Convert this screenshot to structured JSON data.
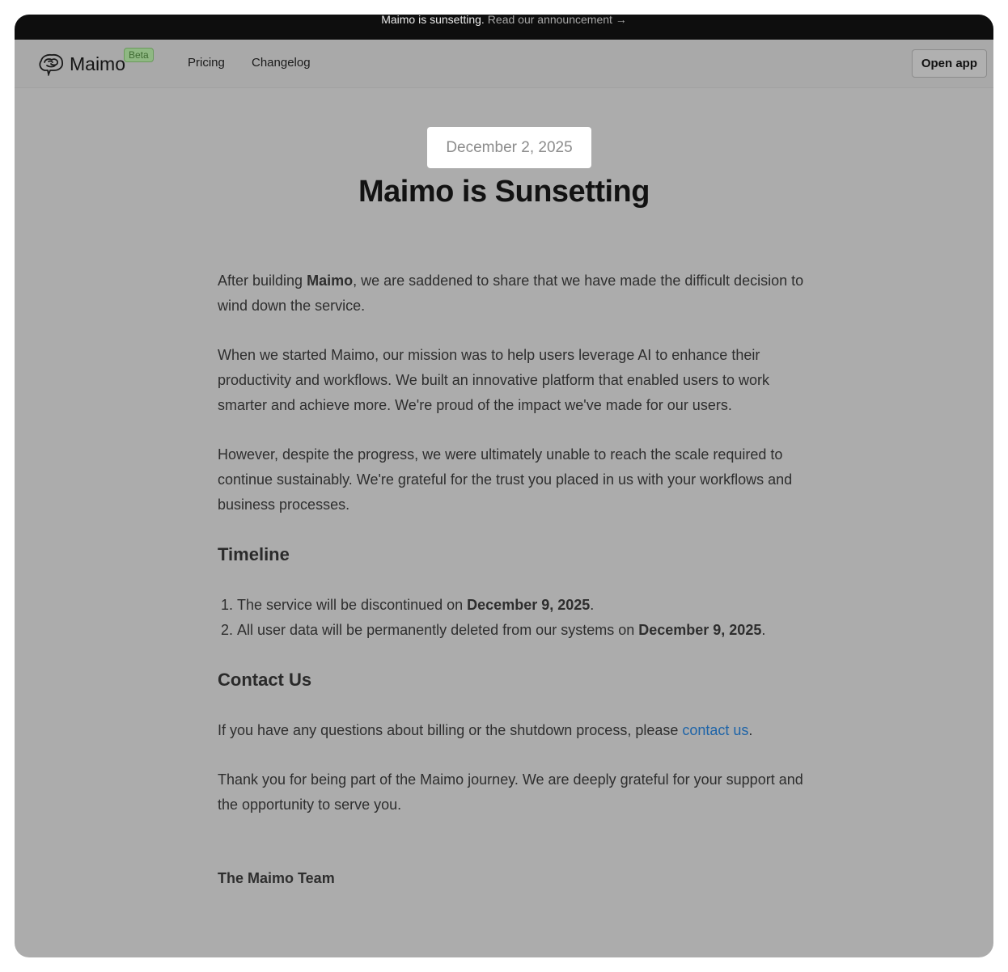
{
  "announcement": {
    "message": "Maimo is sunsetting.",
    "link_text": "Read our announcement →"
  },
  "nav": {
    "brand": "Maimo",
    "badge": "Beta",
    "links": [
      "Pricing",
      "Changelog"
    ],
    "open_app": "Open app"
  },
  "post": {
    "date": "December 2, 2025",
    "title": "Maimo is Sunsetting",
    "p1_before": "After building ",
    "p1_bold": "Maimo",
    "p1_after": ", we are saddened to share that we have made the difficult decision to wind down the service.",
    "p2": "When we started Maimo, our mission was to help users leverage AI to enhance their productivity and workflows. We built an innovative platform that enabled users to work smarter and achieve more. We're proud of the impact we've made for our users.",
    "p3": "However, despite the progress, we were ultimately unable to reach the scale required to continue sustainably. We're grateful for the trust you placed in us with your workflows and business processes.",
    "timeline_heading": "Timeline",
    "timeline": [
      {
        "text": "The service will be discontinued on ",
        "bold": "December 9, 2025",
        "end": "."
      },
      {
        "text": "All user data will be permanently deleted from our systems on ",
        "bold": "December 9, 2025",
        "end": "."
      }
    ],
    "contact_heading": "Contact Us",
    "contact_before": "If you have any questions about billing or the shutdown process, please ",
    "contact_link": "contact us",
    "contact_after": ".",
    "thanks": "Thank you for being part of the Maimo journey. We are deeply grateful for your support and the opportunity to serve you.",
    "signature": "The Maimo Team"
  },
  "colors": {
    "overlay": "#acacac",
    "announcement_bg": "#0e0e0e",
    "link": "#1e64a8",
    "badge": "#8fb883"
  }
}
